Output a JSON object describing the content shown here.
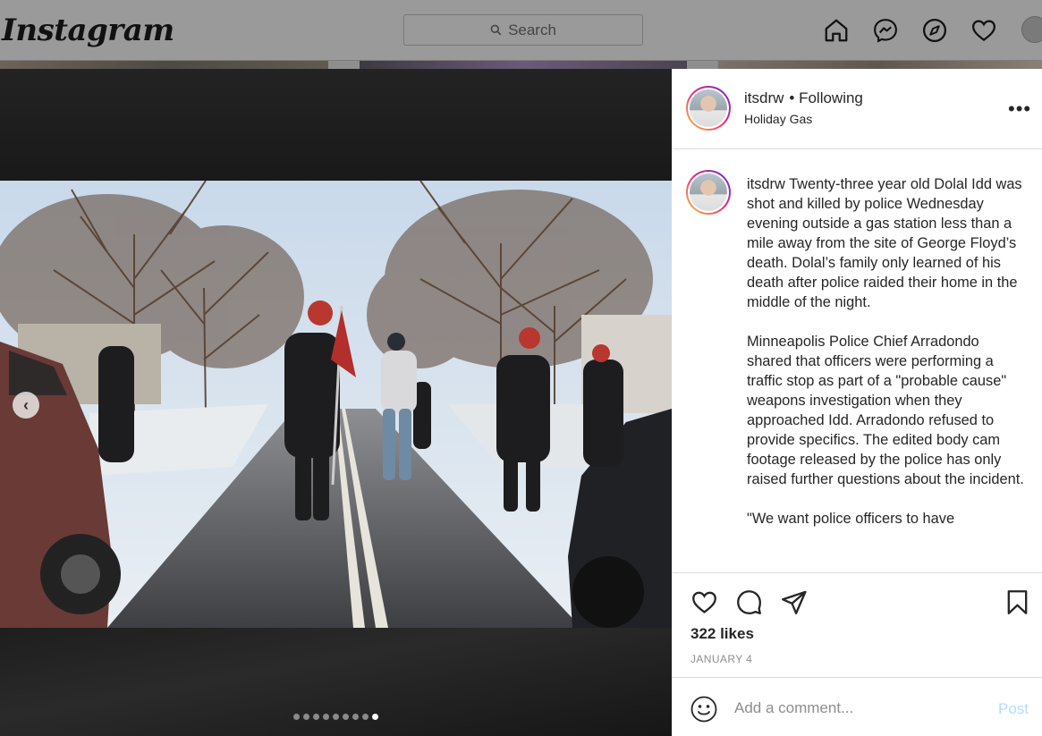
{
  "topbar": {
    "logo": "Instagram",
    "search_placeholder": "Search",
    "icons": [
      "home-icon",
      "messenger-icon",
      "explore-icon",
      "heart-icon",
      "profile-avatar"
    ]
  },
  "post": {
    "header": {
      "username": "itsdrw",
      "follow_status": "• Following",
      "location": "Holiday Gas"
    },
    "caption": {
      "username": "itsdrw",
      "paragraphs": [
        "Twenty-three year old Dolal Idd was shot and killed by police Wednesday evening outside a gas station less than a mile away from the site of George Floyd’s death. Dolal’s family only learned of his death after police raided their home in the middle of the night.",
        "Minneapolis Police Chief Arradondo shared that officers were performing a traffic stop as part of a \"probable cause\" weapons investigation when they approached Idd.  Arradondo refused to provide specifics. The edited body cam footage released by the police has only raised further questions about the incident.",
        "\"We want police officers to have"
      ]
    },
    "likes": "322 likes",
    "date": "JANUARY 4",
    "carousel": {
      "total": 9,
      "active_index": 8
    },
    "comment": {
      "placeholder": "Add a comment...",
      "post_label": "Post"
    }
  },
  "colors": {
    "follow_blue": "#0095f6",
    "post_disabled": "#b3dbff",
    "story_ring": [
      "#f9ce34",
      "#ee2a7b",
      "#6228d7"
    ]
  }
}
